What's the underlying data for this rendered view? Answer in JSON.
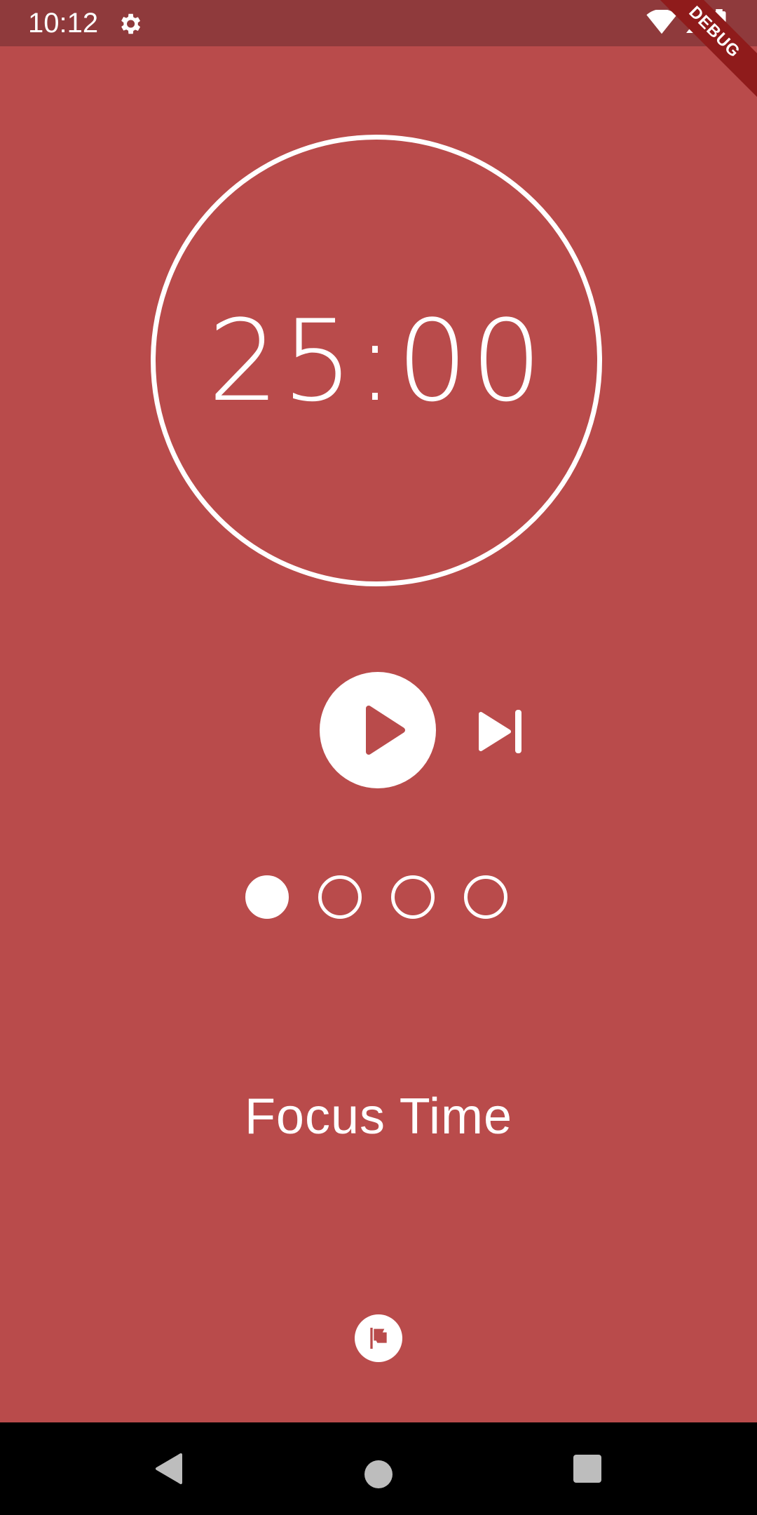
{
  "status_bar": {
    "time": "10:12",
    "settings_icon": "gear-icon",
    "wifi_icon": "wifi-icon",
    "signal_icon": "signal-icon",
    "battery_icon": "battery-icon",
    "debug_label": "DEBUG"
  },
  "timer": {
    "display": "25:00"
  },
  "controls": {
    "play_icon": "play-icon",
    "skip_icon": "skip-next-icon"
  },
  "sessions": {
    "total": 4,
    "completed": 1
  },
  "mode": {
    "label": "Focus Time"
  },
  "bottom": {
    "flag_icon": "flag-icon"
  },
  "colors": {
    "background": "#b94b4b",
    "status_bar": "#8f3a3c",
    "foreground": "#ffffff",
    "debug_banner": "#8f1b1b"
  },
  "nav": {
    "back_icon": "back-triangle-icon",
    "home_icon": "home-circle-icon",
    "recents_icon": "recents-square-icon"
  }
}
